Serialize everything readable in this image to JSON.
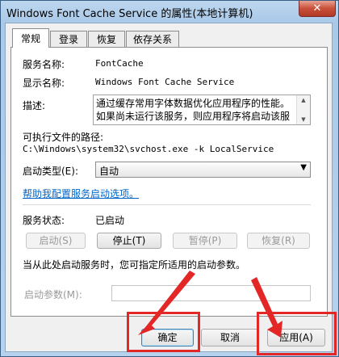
{
  "window": {
    "title": "Windows Font Cache Service 的属性(本地计算机)",
    "close_glyph": "✕"
  },
  "tabs": [
    "常规",
    "登录",
    "恢复",
    "依存关系"
  ],
  "general": {
    "service_name_label": "服务名称:",
    "service_name_value": "FontCache",
    "display_name_label": "显示名称:",
    "display_name_value": "Windows Font Cache Service",
    "description_label": "描述:",
    "description_text": "通过缓存常用字体数据优化应用程序的性能。如果尚未运行该服务，则应用程序将启动该服",
    "exe_path_label": "可执行文件的路径:",
    "exe_path_value": "C:\\Windows\\system32\\svchost.exe -k LocalService",
    "startup_type_label": "启动类型(E):",
    "startup_type_value": "自动",
    "help_link": "帮助我配置服务启动选项。",
    "service_status_label": "服务状态:",
    "service_status_value": "已启动",
    "buttons": {
      "start": "启动(S)",
      "stop": "停止(T)",
      "pause": "暂停(P)",
      "resume": "恢复(R)"
    },
    "start_params_hint": "当从此处启动服务时，您可指定所适用的启动参数。",
    "start_params_label": "启动参数(M):",
    "start_params_value": ""
  },
  "footer": {
    "ok": "确定",
    "cancel": "取消",
    "apply": "应用(A)"
  },
  "annotation_color": "#e32626"
}
